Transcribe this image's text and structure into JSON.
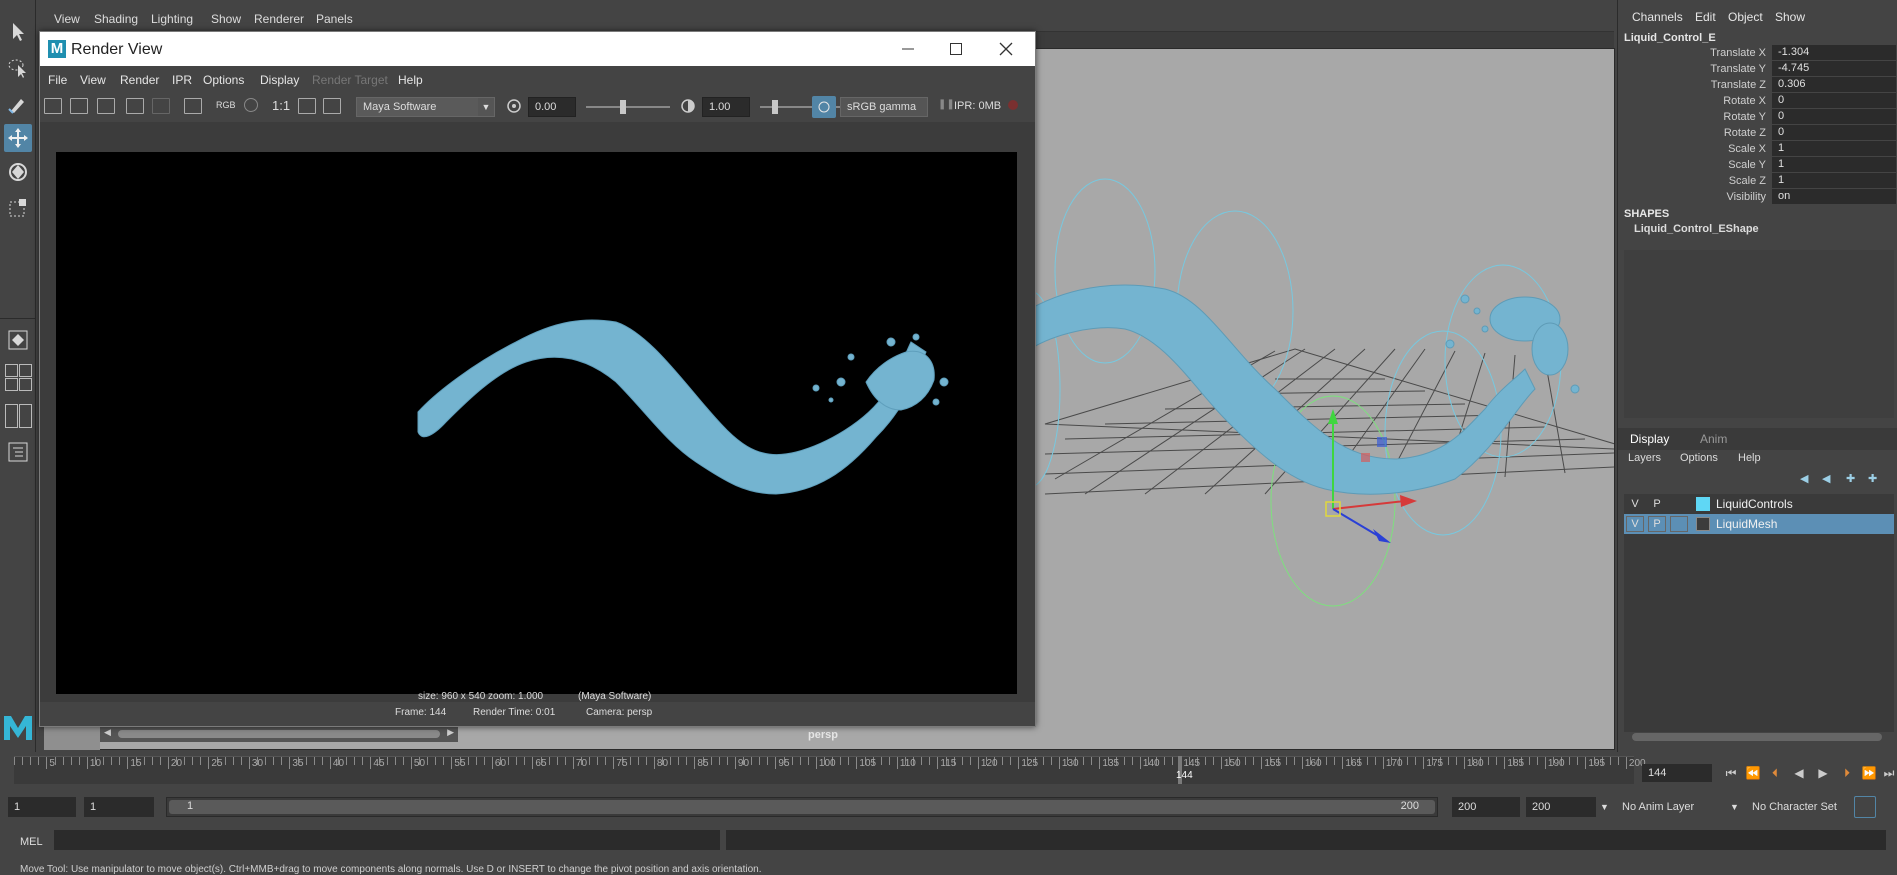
{
  "viewport": {
    "menus": [
      "View",
      "Shading",
      "Lighting",
      "Show",
      "Renderer",
      "Panels"
    ],
    "camera_label": "persp"
  },
  "render_view": {
    "title": "Render View",
    "logo_letter": "M",
    "menus": [
      "File",
      "View",
      "Render",
      "IPR",
      "Options",
      "Display",
      "Render Target",
      "Help"
    ],
    "disabled_menus": [
      "Render Target"
    ],
    "one_to_one": "1:1",
    "rgb_label": "RGB",
    "renderer": "Maya Software",
    "exposure": "0.00",
    "gamma": "1.00",
    "color_space": "sRGB gamma",
    "ipr_memory": "IPR: 0MB",
    "info_line1_size": "size: 960 x 540 zoom: 1.000",
    "info_line1_renderer": "(Maya Software)",
    "info_frame": "Frame: 144",
    "info_render_time": "Render Time: 0:01",
    "info_camera": "Camera: persp"
  },
  "channel_box": {
    "menus": [
      "Channels",
      "Edit",
      "Object",
      "Show"
    ],
    "object_name": "Liquid_Control_E",
    "channels": [
      {
        "label": "Translate X",
        "value": "-1.304"
      },
      {
        "label": "Translate Y",
        "value": "-4.745"
      },
      {
        "label": "Translate Z",
        "value": "0.306"
      },
      {
        "label": "Rotate X",
        "value": "0"
      },
      {
        "label": "Rotate Y",
        "value": "0"
      },
      {
        "label": "Rotate Z",
        "value": "0"
      },
      {
        "label": "Scale X",
        "value": "1"
      },
      {
        "label": "Scale Y",
        "value": "1"
      },
      {
        "label": "Scale Z",
        "value": "1"
      },
      {
        "label": "Visibility",
        "value": "on"
      }
    ],
    "shapes_header": "SHAPES",
    "shape_name": "Liquid_Control_EShape"
  },
  "layer_editor": {
    "tabs": [
      "Display",
      "Anim"
    ],
    "menus": [
      "Layers",
      "Options",
      "Help"
    ],
    "v_label": "V",
    "p_label": "P",
    "layers": [
      {
        "name": "LiquidControls",
        "color": "#5fd7f5",
        "selected": false
      },
      {
        "name": "LiquidMesh",
        "color": "#3c3c3c",
        "selected": true
      }
    ]
  },
  "time_slider": {
    "tick_labels": [
      "5",
      "10",
      "15",
      "20",
      "25",
      "30",
      "35",
      "40",
      "45",
      "50",
      "55",
      "60",
      "65",
      "70",
      "75",
      "80",
      "85",
      "90",
      "95",
      "100",
      "105",
      "110",
      "115",
      "120",
      "125",
      "130",
      "135",
      "140",
      "145",
      "150",
      "155",
      "160",
      "165",
      "170",
      "175",
      "180",
      "185",
      "190",
      "195",
      "200"
    ],
    "current_frame": "144",
    "current_frame_marker": "144",
    "start": 1,
    "end": 200
  },
  "range_slider": {
    "start_field": "1",
    "current_start": "1",
    "slider_start": "1",
    "slider_end": "200",
    "end_field": "200",
    "max_field": "200",
    "anim_layer": "No Anim Layer",
    "character_set": "No Character Set"
  },
  "command_line": {
    "mel_label": "MEL",
    "help_text": "Move Tool: Use manipulator to move object(s). Ctrl+MMB+drag to move components along normals. Use D or INSERT to change the pivot position and axis orientation."
  },
  "colors": {
    "accent": "#5285a6",
    "liquid": "#74b4d0",
    "selected_row": "#5c8fb5"
  }
}
